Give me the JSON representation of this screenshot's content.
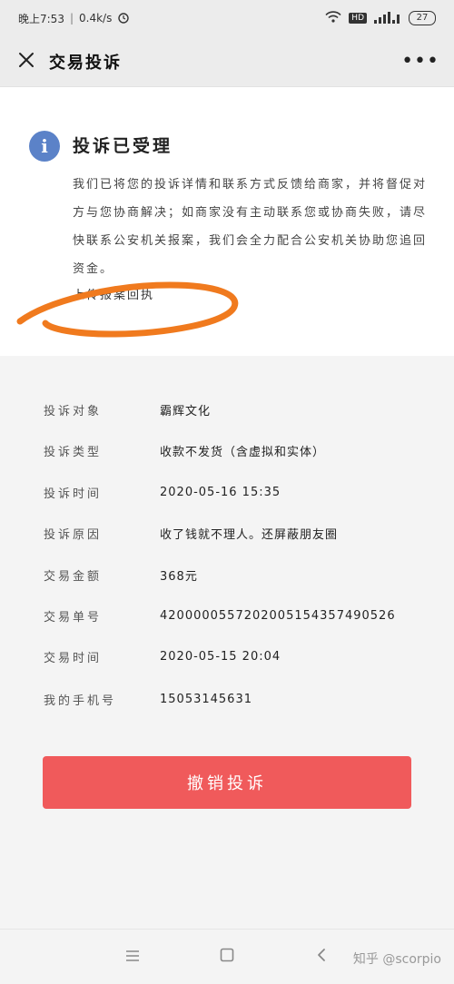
{
  "status_bar": {
    "time": "晚上7:53",
    "speed": "0.4k/s",
    "network": "4G",
    "hd": "HD",
    "battery": "27"
  },
  "nav": {
    "title": "交易投诉"
  },
  "notice": {
    "title": "投诉已受理",
    "body": "我们已将您的投诉详情和联系方式反馈给商家，并将督促对方与您协商解决；如商家没有主动联系您或协商失败，请尽快联系公安机关报案，我们会全力配合公安机关协助您追回资金。",
    "upload_link": "上传报案回执"
  },
  "details": [
    {
      "label": "投诉对象",
      "value": "霸辉文化"
    },
    {
      "label": "投诉类型",
      "value": "收款不发货（含虚拟和实体）"
    },
    {
      "label": "投诉时间",
      "value": "2020-05-16 15:35"
    },
    {
      "label": "投诉原因",
      "value": "收了钱就不理人。还屏蔽朋友圈"
    },
    {
      "label": "交易金额",
      "value": "368元"
    },
    {
      "label": "交易单号",
      "value": "4200000557202005154357490526"
    },
    {
      "label": "交易时间",
      "value": "2020-05-15 20:04"
    },
    {
      "label": "我的手机号",
      "value": "15053145631"
    }
  ],
  "cancel_button": "撤销投诉",
  "watermark": "知乎 @scorpio",
  "colors": {
    "accent_red": "#f05a5b",
    "info_blue": "#5b82c8",
    "scribble_orange": "#f07a1e"
  }
}
